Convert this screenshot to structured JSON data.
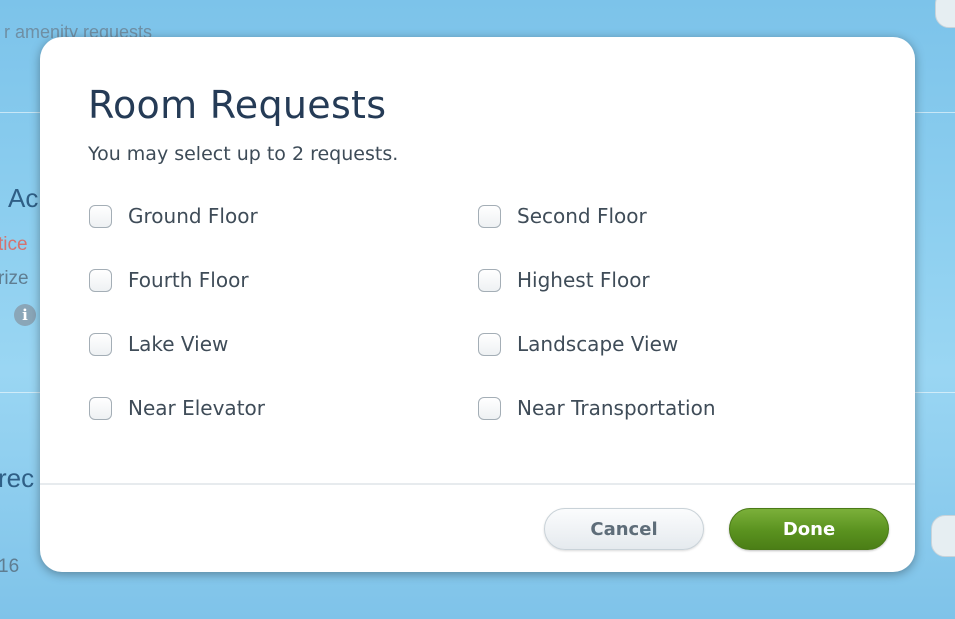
{
  "background": {
    "top_subtitle": "r amenity requests",
    "section_title_partial": "Ac",
    "notice_partial": "tice",
    "text_partial": "rize",
    "dot_partial": ".",
    "section_title2_partial": "rec",
    "number_partial": "16"
  },
  "dialog": {
    "title": "Room Requests",
    "subtitle": "You may select up to 2 requests.",
    "options": [
      {
        "label": "Ground Floor",
        "checked": false
      },
      {
        "label": "Second Floor",
        "checked": false
      },
      {
        "label": "Fourth Floor",
        "checked": false
      },
      {
        "label": "Highest Floor",
        "checked": false
      },
      {
        "label": "Lake View",
        "checked": false
      },
      {
        "label": "Landscape View",
        "checked": false
      },
      {
        "label": "Near Elevator",
        "checked": false
      },
      {
        "label": "Near Transportation",
        "checked": false
      }
    ],
    "cancel_label": "Cancel",
    "done_label": "Done"
  },
  "colors": {
    "done_button": "#5a921f",
    "title_text": "#253b56",
    "backdrop": "#8fd0f0"
  }
}
